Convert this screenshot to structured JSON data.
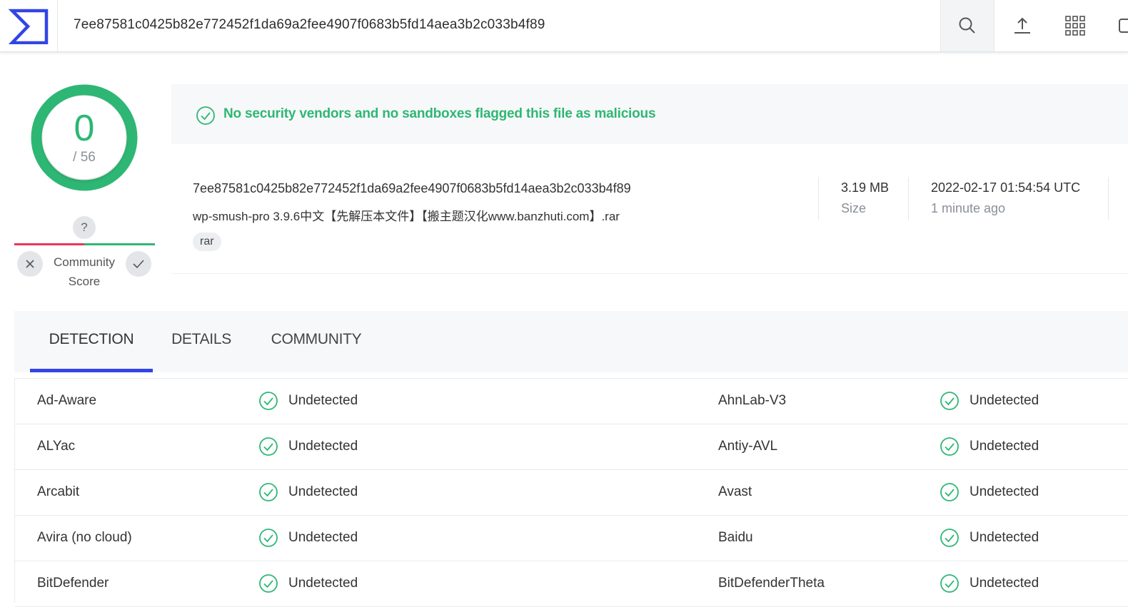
{
  "header": {
    "search_value": "7ee87581c0425b82e772452f1da69a2fee4907f0683b5fd14aea3b2c033b4f89",
    "icons": [
      "logo-icon",
      "search-icon",
      "upload-icon",
      "apps-grid-icon"
    ]
  },
  "score": {
    "detected": "0",
    "total": "/ 56",
    "community_label_line1": "Community",
    "community_label_line2": "Score",
    "unknown_mark": "?"
  },
  "banner": {
    "text": "No security vendors and no sandboxes flagged this file as malicious"
  },
  "file": {
    "hash": "7ee87581c0425b82e772452f1da69a2fee4907f0683b5fd14aea3b2c033b4f89",
    "name": "wp-smush-pro 3.9.6中文【先解压本文件】【搬主题汉化www.banzhuti.com】.rar",
    "tag": "rar",
    "size_value": "3.19 MB",
    "size_label": "Size",
    "date_value": "2022-02-17 01:54:54 UTC",
    "date_label": "1 minute ago"
  },
  "tabs": {
    "detection": "DETECTION",
    "details": "DETAILS",
    "community": "COMMUNITY"
  },
  "detections": [
    {
      "left_engine": "Ad-Aware",
      "left_result": "Undetected",
      "right_engine": "AhnLab-V3",
      "right_result": "Undetected"
    },
    {
      "left_engine": "ALYac",
      "left_result": "Undetected",
      "right_engine": "Antiy-AVL",
      "right_result": "Undetected"
    },
    {
      "left_engine": "Arcabit",
      "left_result": "Undetected",
      "right_engine": "Avast",
      "right_result": "Undetected"
    },
    {
      "left_engine": "Avira (no cloud)",
      "left_result": "Undetected",
      "right_engine": "Baidu",
      "right_result": "Undetected"
    },
    {
      "left_engine": "BitDefender",
      "left_result": "Undetected",
      "right_engine": "BitDefenderTheta",
      "right_result": "Undetected"
    }
  ],
  "colors": {
    "accent_blue": "#3145e6",
    "clean_green": "#2eb774",
    "malicious_red": "#e8375b"
  }
}
